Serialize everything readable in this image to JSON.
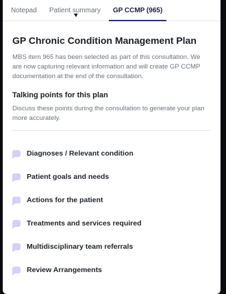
{
  "tabs": [
    {
      "label": "Notepad"
    },
    {
      "label": "Patient summary"
    },
    {
      "label": "GP CCMP (965)"
    }
  ],
  "plan": {
    "title": "GP Chronic Condition Management Plan",
    "description": "MBS item 965 has been selected as part of this consultation. We are now capturing relevant information and will create GP CCMP documentation at the end of the consultation."
  },
  "talking_points": {
    "heading": "Talking points for this plan",
    "subtext": "Discuss these points during the consultation to generate your plan more accurately."
  },
  "items": [
    {
      "label": "Diagnoses / Relevant condition"
    },
    {
      "label": "Patient goals and needs"
    },
    {
      "label": "Actions for the patient"
    },
    {
      "label": "Treatments and services required"
    },
    {
      "label": "Multidisciplinary team referrals"
    },
    {
      "label": "Review Arrangements"
    }
  ],
  "colors": {
    "accent": "#2b2f6b",
    "bubble": "#d7cff7",
    "muted_text": "#6d727a"
  },
  "icons": {
    "item_icon": "speech-bubble-icon",
    "cursor": "mouse-pointer-icon"
  }
}
